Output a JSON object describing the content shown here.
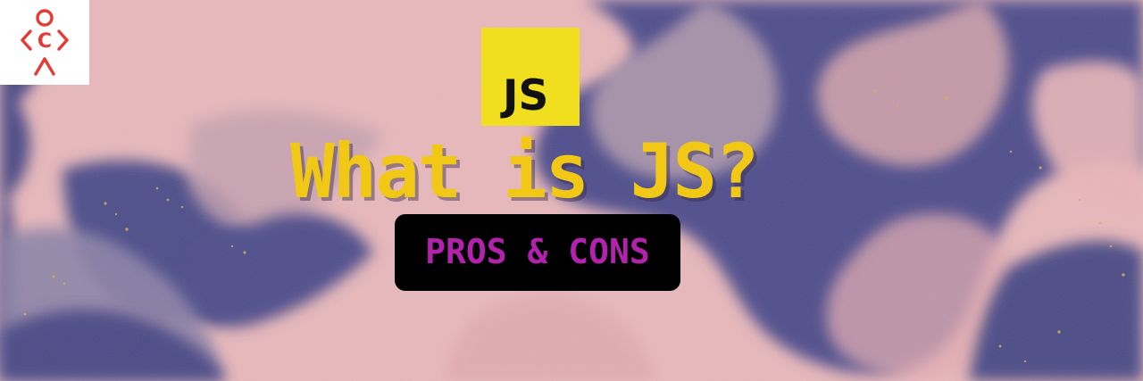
{
  "banner": {
    "logo_text": "OCA",
    "badge_text": "JS",
    "headline": "What is JS?",
    "subtitle": "PROS & CONS",
    "colors": {
      "background_pink": "#e8b8bb",
      "background_navy": "#4b4a86",
      "badge_yellow": "#f1df1f",
      "headline_yellow": "#f2c817",
      "subtitle_magenta": "#b322ad",
      "pill_black": "#000000",
      "logo_red": "#e53a35"
    }
  }
}
